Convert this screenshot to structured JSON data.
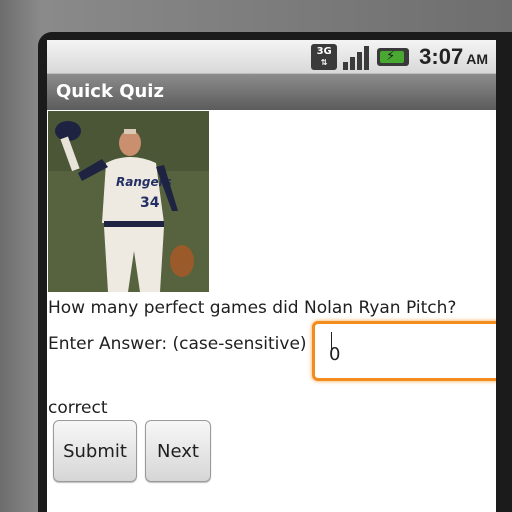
{
  "status_bar": {
    "network_label": "3G",
    "time": "3:07",
    "ampm": "AM"
  },
  "app": {
    "title": "Quick Quiz"
  },
  "quiz": {
    "question": "How many perfect games did Nolan Ryan Pitch?",
    "answer_label": "Enter Answer: (case-sensitive)",
    "answer_value": "0",
    "result_text": "correct",
    "submit_label": "Submit",
    "next_label": "Next"
  },
  "photo": {
    "jersey_text": "Rangers",
    "jersey_number": "34"
  },
  "colors": {
    "accent_focus": "#f28c1e",
    "title_bar": "#6e6e6e",
    "battery_green": "#48a831"
  }
}
